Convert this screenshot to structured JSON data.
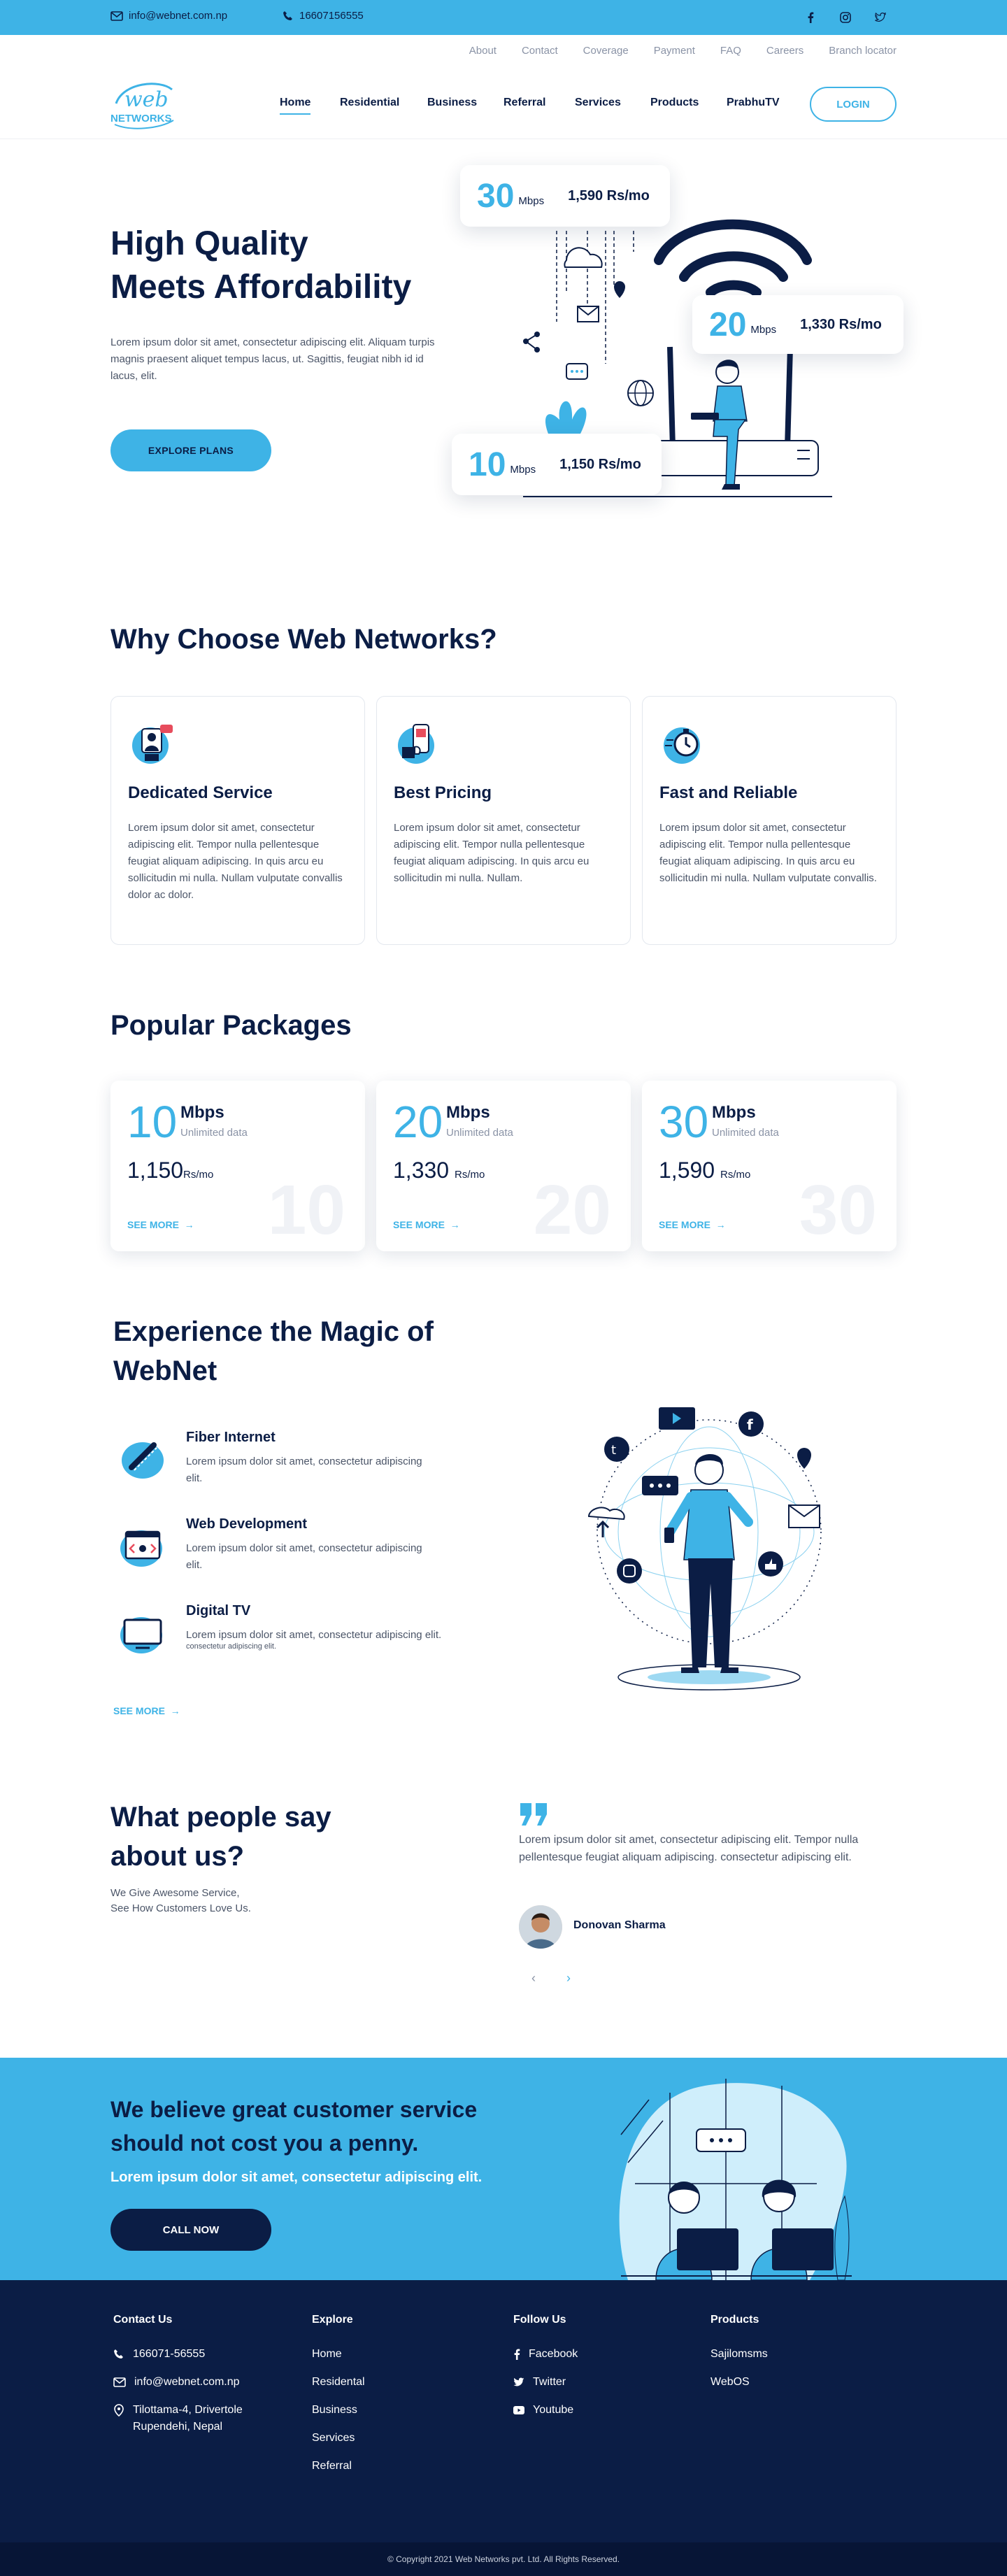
{
  "topbar": {
    "email": "info@webnet.com.np",
    "phone": "16607156555",
    "social": [
      "facebook-icon",
      "instagram-icon",
      "twitter-icon"
    ]
  },
  "sublinks": [
    "About",
    "Contact",
    "Coverage",
    "Payment",
    "FAQ",
    "Careers",
    "Branch locator"
  ],
  "logo": {
    "text1": "web",
    "text2": "NETWORKS"
  },
  "nav": {
    "items": [
      "Home",
      "Residential",
      "Business",
      "Referral",
      "Services",
      "Products",
      "PrabhuTV"
    ],
    "active": "Home",
    "login": "LOGIN"
  },
  "hero": {
    "title_line1": "High Quality",
    "title_line2": "Meets Affordability",
    "desc": "Lorem ipsum dolor sit amet, consectetur adipiscing elit. Aliquam turpis magnis praesent aliquet tempus lacus, ut. Sagittis, feugiat nibh id id lacus, elit.",
    "cta": "EXPLORE PLANS",
    "cards": [
      {
        "speed": "30",
        "unit": "Mbps",
        "price": "1,590 Rs/mo"
      },
      {
        "speed": "20",
        "unit": "Mbps",
        "price": "1,330 Rs/mo"
      },
      {
        "speed": "10",
        "unit": "Mbps",
        "price": "1,150 Rs/mo"
      }
    ]
  },
  "why": {
    "title": "Why Choose Web Networks?",
    "cards": [
      {
        "title": "Dedicated Service",
        "text": "Lorem ipsum dolor sit amet, consectetur adipiscing elit. Tempor nulla pellentesque feugiat aliquam adipiscing. In quis arcu eu sollicitudin mi nulla. Nullam vulputate convallis dolor ac dolor."
      },
      {
        "title": "Best Pricing",
        "text": "Lorem ipsum dolor sit amet, consectetur adipiscing elit. Tempor nulla pellentesque feugiat aliquam adipiscing. In quis arcu eu sollicitudin mi nulla. Nullam."
      },
      {
        "title": "Fast and Reliable",
        "text": "Lorem ipsum dolor sit amet, consectetur adipiscing elit. Tempor nulla pellentesque feugiat aliquam adipiscing. In quis arcu eu sollicitudin mi nulla. Nullam vulputate convallis."
      }
    ]
  },
  "packages": {
    "title": "Popular Packages",
    "items": [
      {
        "num": "10",
        "unit": "Mbps",
        "data": "Unlimited data",
        "price": "1,150",
        "rs": "Rs/mo",
        "more": "SEE MORE"
      },
      {
        "num": "20",
        "unit": "Mbps",
        "data": "Unlimited data",
        "price": "1,330",
        "rs": "Rs/mo",
        "more": "SEE MORE"
      },
      {
        "num": "30",
        "unit": "Mbps",
        "data": "Unlimited data",
        "price": "1,590",
        "rs": "Rs/mo",
        "more": "SEE MORE"
      }
    ]
  },
  "magic": {
    "title_line1": "Experience the Magic of",
    "title_line2": "WebNet",
    "items": [
      {
        "title": "Fiber Internet",
        "text": "Lorem ipsum dolor sit amet, consectetur adipiscing elit.",
        "extra": ""
      },
      {
        "title": "Web Development",
        "text": "Lorem ipsum dolor sit amet, consectetur adipiscing elit.",
        "extra": ""
      },
      {
        "title": "Digital TV",
        "text": "Lorem ipsum dolor sit amet, consectetur adipiscing elit.",
        "extra": "consectetur adipiscing elit."
      }
    ],
    "more": "SEE MORE"
  },
  "testimonials": {
    "title_line1": "What people say",
    "title_line2": "about us?",
    "sub_line1": "We Give Awesome Service,",
    "sub_line2": "See How Customers Love Us.",
    "quote": "Lorem ipsum dolor sit amet, consectetur adipiscing elit. Tempor nulla pellentesque feugiat aliquam adipiscing. consectetur adipiscing elit.",
    "author": "Donovan Sharma",
    "prev": "‹",
    "next": "›"
  },
  "cta": {
    "title": "We believe great customer service should not cost you a penny.",
    "sub": "Lorem ipsum dolor sit amet, consectetur adipiscing elit.",
    "button": "CALL NOW"
  },
  "footer": {
    "contact": {
      "title": "Contact Us",
      "phone": "166071-56555",
      "email": "info@webnet.com.np",
      "address_line1": "Tilottama-4, Drivertole",
      "address_line2": "Rupendehi, Nepal"
    },
    "explore": {
      "title": "Explore",
      "links": [
        "Home",
        "Residental",
        "Business",
        "Services",
        "Referral"
      ]
    },
    "follow": {
      "title": "Follow Us",
      "links": [
        "Facebook",
        "Twitter",
        "Youtube"
      ]
    },
    "products": {
      "title": "Products",
      "links": [
        "Sajilomsms",
        "WebOS"
      ]
    },
    "copyright": "© Copyright 2021 Web Networks pvt. Ltd. All Rights Reserved."
  },
  "colors": {
    "primary": "#3eb3e6",
    "navy": "#0b1d45",
    "footer": "#0b1d45"
  }
}
